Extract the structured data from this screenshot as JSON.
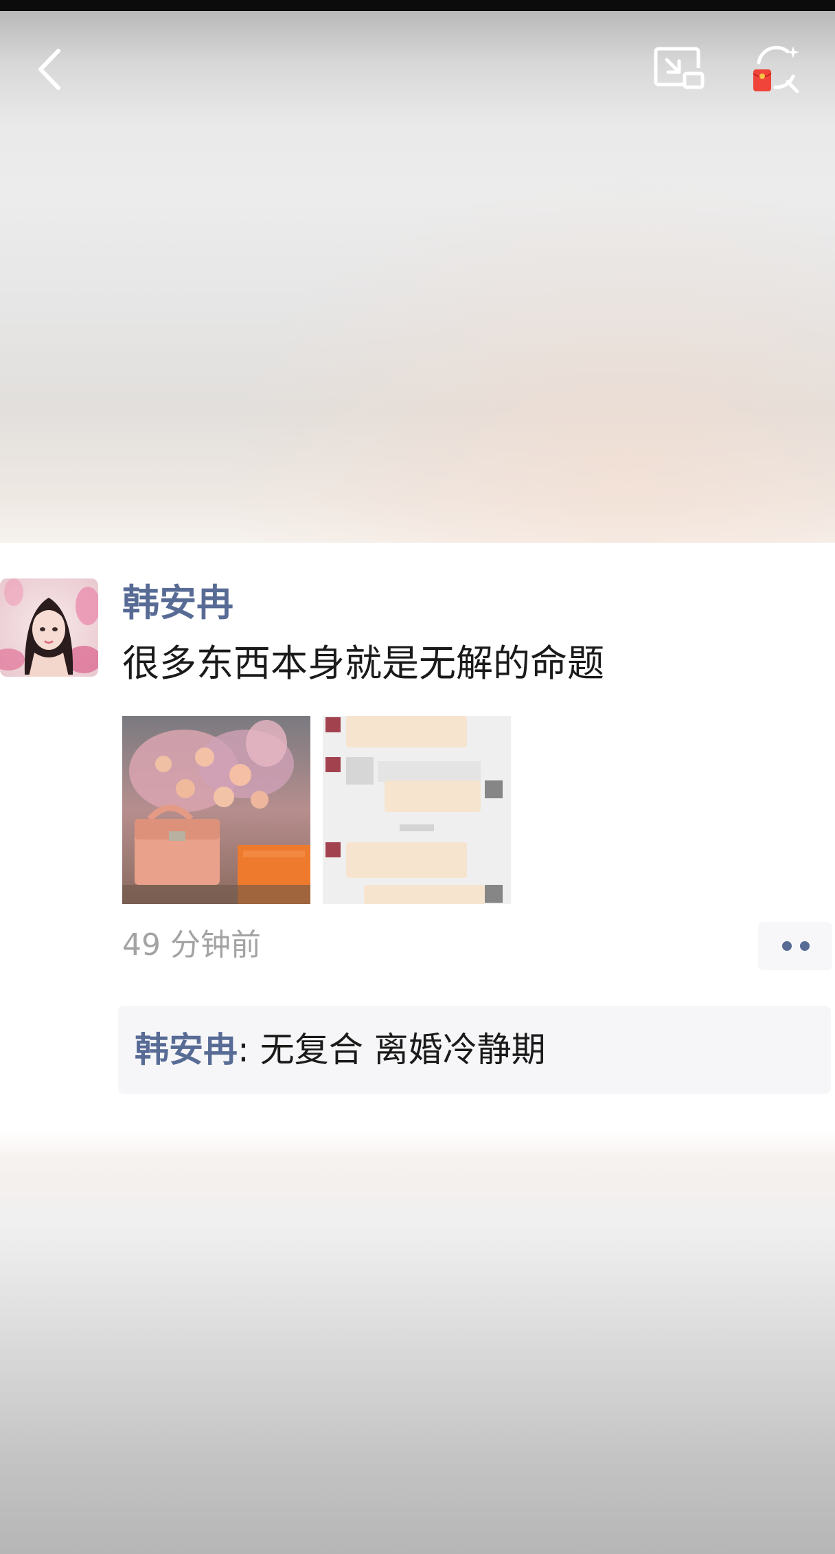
{
  "header": {
    "back_icon": "chevron-left-icon",
    "pip_icon": "picture-in-picture-icon",
    "gift_icon": "red-packet-refresh-icon"
  },
  "post": {
    "author": "韩安冉",
    "text": "很多东西本身就是无解的命题",
    "timestamp": "49 分钟前",
    "images": [
      {
        "name": "flowers-and-handbag-photo"
      },
      {
        "name": "chat-screenshot-photo"
      }
    ],
    "more_icon": "more-dots-icon",
    "comments": [
      {
        "author": "韩安冉",
        "separator": ": ",
        "text": "无复合 离婚冷静期"
      }
    ]
  },
  "colors": {
    "name_link": "#576b95",
    "text": "#1a1a1a",
    "timestamp": "#a3a3a3",
    "comment_bg": "#f6f6f8"
  }
}
